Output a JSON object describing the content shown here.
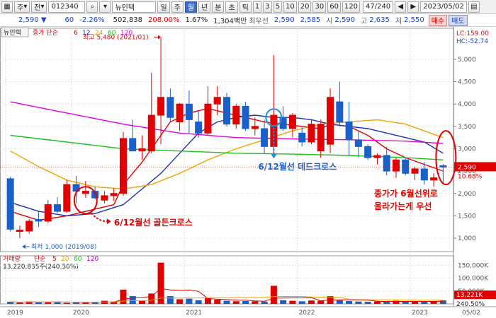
{
  "toolbar": {
    "type_select": "주",
    "market_select": "전",
    "code": "012340",
    "name": "뉴인텍",
    "periods": [
      "일",
      "주",
      "월",
      "년",
      "분",
      "초",
      "틱"
    ],
    "selected_period": "월",
    "intervals": [
      "1",
      "3",
      "5",
      "10",
      "20",
      "30",
      "60",
      "120"
    ],
    "page_count": "47/240",
    "date": "2023/05/02"
  },
  "quote": {
    "price": "2,590",
    "change": "60",
    "change_rate": "-2.26%",
    "volume": "502,838",
    "vol_ratio": "208.00%",
    "turnover": "1.67%",
    "amount": "1,304백만",
    "pref_label": "최우선",
    "ask": "2,590",
    "bid": "2,585",
    "open_label": "시",
    "open": "2,590",
    "high_label": "고",
    "high": "2,635",
    "low_label": "저",
    "low": "2,550",
    "buy_label": "매수",
    "sell_label": "매도"
  },
  "chart_data": [
    {
      "type": "candlestick",
      "name": "뉴인텍",
      "indicator": "종가 단순",
      "ma_periods": [
        "6",
        "12",
        "24",
        "60",
        "120"
      ],
      "ma_colors": [
        "#e00000",
        "#1a2fb0",
        "#f0a000",
        "#20c020",
        "#e000e0"
      ],
      "x_labels": [
        "2019",
        "2020",
        "2021",
        "2022",
        "2023",
        "05/02"
      ],
      "y_ticks": [
        1000,
        1500,
        2000,
        2500,
        3000,
        3500,
        4000,
        4500,
        5000
      ],
      "y_tick_labels": [
        "1,000",
        "1,500",
        "2,000",
        "2,500",
        "3,000",
        "3,500",
        "4,000",
        "4,500",
        "5,000"
      ],
      "ylim": [
        700,
        5600
      ],
      "lc_label": "LC:159.00",
      "hc_label": "HC:-52.74",
      "current_price_label": "2,590",
      "current_rate_label": "10.68%",
      "high_note": "최고 5,480 (2021/01)",
      "low_note": "최저 1,000 (2019/08)",
      "annotations": [
        "6/12월선 골든크로스",
        "6/12월선 데드크로스",
        "종가가 6월선위로",
        "올라가는게 우선"
      ],
      "candles": [
        {
          "o": 2330,
          "h": 2370,
          "l": 1150,
          "c": 1200
        },
        {
          "o": 1150,
          "h": 1280,
          "l": 1000,
          "c": 1180
        },
        {
          "o": 1160,
          "h": 1420,
          "l": 1100,
          "c": 1380
        },
        {
          "o": 1420,
          "h": 1600,
          "l": 1250,
          "c": 1380
        },
        {
          "o": 1380,
          "h": 1850,
          "l": 1340,
          "c": 1750
        },
        {
          "o": 1750,
          "h": 1920,
          "l": 1560,
          "c": 1600
        },
        {
          "o": 1600,
          "h": 2300,
          "l": 1570,
          "c": 2200
        },
        {
          "o": 2200,
          "h": 2390,
          "l": 1780,
          "c": 2050
        },
        {
          "o": 2000,
          "h": 2280,
          "l": 1900,
          "c": 2050
        },
        {
          "o": 2050,
          "h": 2150,
          "l": 1870,
          "c": 1900
        },
        {
          "o": 1850,
          "h": 2050,
          "l": 1780,
          "c": 1950
        },
        {
          "o": 1950,
          "h": 2120,
          "l": 1830,
          "c": 2000
        },
        {
          "o": 2000,
          "h": 3380,
          "l": 1950,
          "c": 3230
        },
        {
          "o": 3230,
          "h": 3650,
          "l": 2950,
          "c": 2950
        },
        {
          "o": 2950,
          "h": 3300,
          "l": 2750,
          "c": 3000
        },
        {
          "o": 2950,
          "h": 4700,
          "l": 2900,
          "c": 3750
        },
        {
          "o": 3750,
          "h": 5480,
          "l": 3100,
          "c": 4150
        },
        {
          "o": 4150,
          "h": 4350,
          "l": 3600,
          "c": 3700
        },
        {
          "o": 3600,
          "h": 4020,
          "l": 3400,
          "c": 4000
        },
        {
          "o": 4000,
          "h": 4300,
          "l": 3350,
          "c": 3650
        },
        {
          "o": 3600,
          "h": 3850,
          "l": 3250,
          "c": 3350
        },
        {
          "o": 3350,
          "h": 4400,
          "l": 3300,
          "c": 4000
        },
        {
          "o": 4000,
          "h": 4400,
          "l": 3750,
          "c": 4150
        },
        {
          "o": 4150,
          "h": 4250,
          "l": 3500,
          "c": 3550
        },
        {
          "o": 3550,
          "h": 4000,
          "l": 3450,
          "c": 3950
        },
        {
          "o": 3950,
          "h": 4050,
          "l": 3400,
          "c": 3450
        },
        {
          "o": 3450,
          "h": 3700,
          "l": 3300,
          "c": 3500
        },
        {
          "o": 3450,
          "h": 3650,
          "l": 2900,
          "c": 3050
        },
        {
          "o": 3050,
          "h": 5100,
          "l": 2800,
          "c": 3750
        },
        {
          "o": 3700,
          "h": 3950,
          "l": 3400,
          "c": 3450
        },
        {
          "o": 3450,
          "h": 3800,
          "l": 3250,
          "c": 3750
        },
        {
          "o": 3350,
          "h": 3500,
          "l": 3050,
          "c": 3150
        },
        {
          "o": 3150,
          "h": 3650,
          "l": 3100,
          "c": 3550
        },
        {
          "o": 2950,
          "h": 3650,
          "l": 2800,
          "c": 3550
        },
        {
          "o": 3100,
          "h": 4350,
          "l": 2900,
          "c": 4150
        },
        {
          "o": 4050,
          "h": 4500,
          "l": 3500,
          "c": 3600
        },
        {
          "o": 3600,
          "h": 4050,
          "l": 2850,
          "c": 3200
        },
        {
          "o": 3200,
          "h": 3400,
          "l": 2800,
          "c": 3050
        },
        {
          "o": 3050,
          "h": 3100,
          "l": 2750,
          "c": 2800
        },
        {
          "o": 2800,
          "h": 2900,
          "l": 2650,
          "c": 2850
        },
        {
          "o": 2850,
          "h": 3050,
          "l": 2400,
          "c": 2500
        },
        {
          "o": 2500,
          "h": 2800,
          "l": 2350,
          "c": 2750
        },
        {
          "o": 2750,
          "h": 2800,
          "l": 2400,
          "c": 2450
        },
        {
          "o": 2450,
          "h": 2600,
          "l": 2300,
          "c": 2550
        },
        {
          "o": 2550,
          "h": 2700,
          "l": 2200,
          "c": 2300
        },
        {
          "o": 2300,
          "h": 2450,
          "l": 2150,
          "c": 2350
        },
        {
          "o": 2620,
          "h": 2660,
          "l": 2220,
          "c": 2590
        }
      ],
      "ma_lines": [
        {
          "period": "6",
          "values": [
            [
              0,
              1600
            ],
            [
              3,
              1400
            ],
            [
              6,
              1500
            ],
            [
              9,
              1650
            ],
            [
              11,
              1750
            ],
            [
              12,
              2200
            ],
            [
              13,
              2450
            ],
            [
              14,
              2700
            ],
            [
              15,
              3000
            ],
            [
              16,
              3300
            ],
            [
              17,
              3600
            ],
            [
              19,
              3800
            ],
            [
              21,
              3900
            ],
            [
              23,
              3800
            ],
            [
              25,
              3700
            ],
            [
              27,
              3600
            ],
            [
              29,
              3550
            ],
            [
              31,
              3500
            ],
            [
              33,
              3450
            ],
            [
              34,
              3550
            ],
            [
              36,
              3500
            ],
            [
              38,
              3300
            ],
            [
              40,
              3000
            ],
            [
              42,
              2800
            ],
            [
              44,
              2650
            ],
            [
              46,
              2500
            ]
          ]
        },
        {
          "period": "12",
          "values": [
            [
              0,
              1800
            ],
            [
              3,
              1600
            ],
            [
              6,
              1500
            ],
            [
              9,
              1550
            ],
            [
              12,
              1750
            ],
            [
              14,
              2100
            ],
            [
              16,
              2450
            ],
            [
              18,
              2900
            ],
            [
              20,
              3350
            ],
            [
              22,
              3600
            ],
            [
              24,
              3700
            ],
            [
              26,
              3750
            ],
            [
              28,
              3700
            ],
            [
              30,
              3700
            ],
            [
              32,
              3650
            ],
            [
              34,
              3550
            ],
            [
              36,
              3500
            ],
            [
              38,
              3450
            ],
            [
              40,
              3350
            ],
            [
              42,
              3250
            ],
            [
              44,
              3150
            ],
            [
              46,
              2900
            ]
          ]
        },
        {
          "period": "24",
          "values": [
            [
              0,
              2950
            ],
            [
              3,
              2600
            ],
            [
              6,
              2300
            ],
            [
              9,
              2150
            ],
            [
              12,
              2100
            ],
            [
              15,
              2200
            ],
            [
              18,
              2450
            ],
            [
              21,
              2750
            ],
            [
              24,
              3000
            ],
            [
              27,
              3200
            ],
            [
              30,
              3400
            ],
            [
              33,
              3550
            ],
            [
              36,
              3600
            ],
            [
              39,
              3650
            ],
            [
              42,
              3550
            ],
            [
              44,
              3400
            ],
            [
              46,
              3250
            ]
          ]
        },
        {
          "period": "60",
          "values": [
            [
              0,
              3300
            ],
            [
              6,
              3150
            ],
            [
              12,
              3000
            ],
            [
              18,
              2950
            ],
            [
              24,
              2900
            ],
            [
              30,
              2880
            ],
            [
              36,
              2850
            ],
            [
              42,
              2800
            ],
            [
              46,
              2750
            ]
          ]
        },
        {
          "period": "120",
          "values": [
            [
              0,
              4050
            ],
            [
              6,
              3800
            ],
            [
              12,
              3550
            ],
            [
              18,
              3350
            ],
            [
              24,
              3250
            ],
            [
              30,
              3220
            ],
            [
              36,
              3200
            ],
            [
              42,
              3170
            ],
            [
              46,
              3120
            ]
          ]
        }
      ]
    },
    {
      "type": "bar",
      "name": "거래량",
      "indicator": "단순",
      "ma_periods": [
        "5",
        "20",
        "60",
        "120"
      ],
      "ma_colors": [
        "#e00000",
        "#f0a000",
        "#20c020",
        "#b000b0"
      ],
      "header_value": "13,220,835주(240.50%)",
      "y_ticks": [
        50000,
        100000,
        150000
      ],
      "y_tick_labels": [
        "50,000K",
        "100,000K",
        "150,000K"
      ],
      "ylim": [
        0,
        170000
      ],
      "current_label": "13,221K",
      "current_rate_label": "240.50%",
      "values": [
        8000,
        5000,
        9000,
        6000,
        7000,
        9000,
        4000,
        6000,
        5000,
        7000,
        12000,
        9000,
        55000,
        30000,
        12000,
        40000,
        160000,
        30000,
        18000,
        20000,
        14000,
        22000,
        16000,
        12000,
        10000,
        11000,
        10000,
        9000,
        70000,
        14000,
        12000,
        10000,
        13000,
        12000,
        30000,
        14000,
        11000,
        9000,
        8000,
        9000,
        10000,
        12000,
        9000,
        8000,
        9000,
        10000,
        13221
      ],
      "up": [
        false,
        true,
        true,
        false,
        true,
        false,
        true,
        false,
        true,
        false,
        true,
        true,
        true,
        false,
        true,
        true,
        true,
        false,
        true,
        false,
        false,
        true,
        true,
        false,
        true,
        false,
        true,
        false,
        true,
        false,
        true,
        false,
        true,
        true,
        true,
        false,
        false,
        false,
        false,
        true,
        false,
        true,
        false,
        true,
        false,
        true,
        false
      ]
    }
  ]
}
